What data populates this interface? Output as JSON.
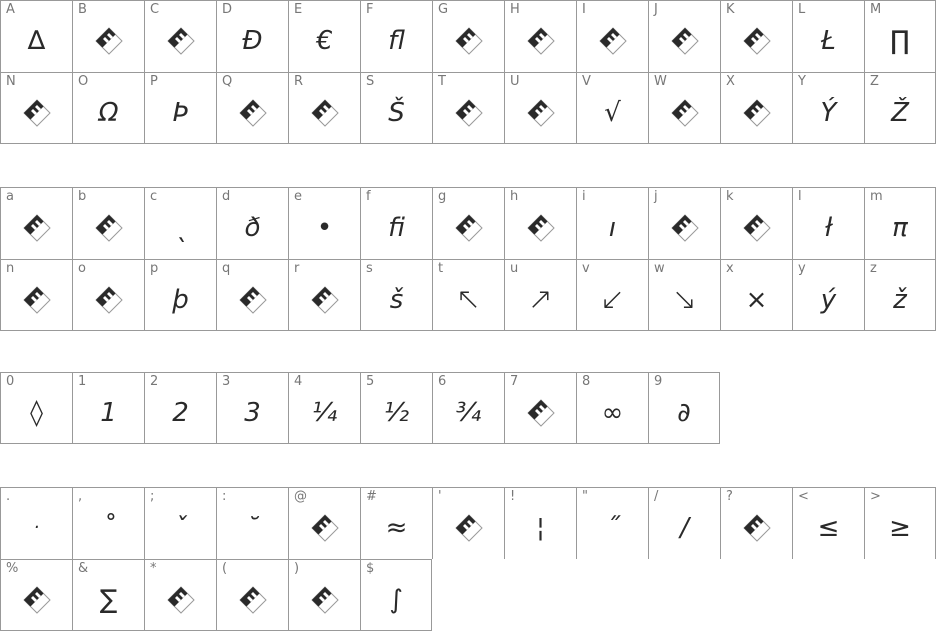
{
  "colors": {
    "border": "#999999",
    "label": "#777777",
    "glyph": "#2a2a2a",
    "placeholder_dark": "#2a2a2a",
    "placeholder_light": "#ffffff"
  },
  "placeholder_icon": "missing-glyph-icon",
  "sections": [
    {
      "name": "uppercase",
      "rows": [
        [
          {
            "label": "A",
            "glyph": "∆"
          },
          {
            "label": "B",
            "glyph": null
          },
          {
            "label": "C",
            "glyph": null
          },
          {
            "label": "D",
            "glyph": "Đ"
          },
          {
            "label": "E",
            "glyph": "€"
          },
          {
            "label": "F",
            "glyph": "fl"
          },
          {
            "label": "G",
            "glyph": null
          },
          {
            "label": "H",
            "glyph": null
          },
          {
            "label": "I",
            "glyph": null
          },
          {
            "label": "J",
            "glyph": null
          },
          {
            "label": "K",
            "glyph": null
          },
          {
            "label": "L",
            "glyph": "Ł"
          },
          {
            "label": "M",
            "glyph": "∏"
          }
        ],
        [
          {
            "label": "N",
            "glyph": null
          },
          {
            "label": "O",
            "glyph": "Ω"
          },
          {
            "label": "P",
            "glyph": "Þ"
          },
          {
            "label": "Q",
            "glyph": null
          },
          {
            "label": "R",
            "glyph": null
          },
          {
            "label": "S",
            "glyph": "Š"
          },
          {
            "label": "T",
            "glyph": null
          },
          {
            "label": "U",
            "glyph": null
          },
          {
            "label": "V",
            "glyph": "√"
          },
          {
            "label": "W",
            "glyph": null
          },
          {
            "label": "X",
            "glyph": null
          },
          {
            "label": "Y",
            "glyph": "Ý"
          },
          {
            "label": "Z",
            "glyph": "Ž"
          }
        ]
      ]
    },
    {
      "name": "lowercase",
      "rows": [
        [
          {
            "label": "a",
            "glyph": null
          },
          {
            "label": "b",
            "glyph": null
          },
          {
            "label": "c",
            "glyph": "ˎ"
          },
          {
            "label": "d",
            "glyph": "ð"
          },
          {
            "label": "e",
            "glyph": "•"
          },
          {
            "label": "f",
            "glyph": "fi"
          },
          {
            "label": "g",
            "glyph": null
          },
          {
            "label": "h",
            "glyph": null
          },
          {
            "label": "i",
            "glyph": "ı"
          },
          {
            "label": "j",
            "glyph": null
          },
          {
            "label": "k",
            "glyph": null
          },
          {
            "label": "l",
            "glyph": "ł"
          },
          {
            "label": "m",
            "glyph": "π"
          }
        ],
        [
          {
            "label": "n",
            "glyph": null
          },
          {
            "label": "o",
            "glyph": null
          },
          {
            "label": "p",
            "glyph": "þ"
          },
          {
            "label": "q",
            "glyph": null
          },
          {
            "label": "r",
            "glyph": null
          },
          {
            "label": "s",
            "glyph": "š"
          },
          {
            "label": "t",
            "glyph": "↖",
            "kind": "arrow"
          },
          {
            "label": "u",
            "glyph": "↗",
            "kind": "arrow"
          },
          {
            "label": "v",
            "glyph": "↙",
            "kind": "arrow"
          },
          {
            "label": "w",
            "glyph": "↘",
            "kind": "arrow"
          },
          {
            "label": "x",
            "glyph": "×"
          },
          {
            "label": "y",
            "glyph": "ý"
          },
          {
            "label": "z",
            "glyph": "ž"
          }
        ]
      ]
    },
    {
      "name": "digits",
      "rows": [
        [
          {
            "label": "0",
            "glyph": "◊"
          },
          {
            "label": "1",
            "glyph": "1"
          },
          {
            "label": "2",
            "glyph": "2"
          },
          {
            "label": "3",
            "glyph": "3"
          },
          {
            "label": "4",
            "glyph": "¼"
          },
          {
            "label": "5",
            "glyph": "½"
          },
          {
            "label": "6",
            "glyph": "¾"
          },
          {
            "label": "7",
            "glyph": null
          },
          {
            "label": "8",
            "glyph": "∞"
          },
          {
            "label": "9",
            "glyph": "∂"
          }
        ]
      ]
    },
    {
      "name": "punctuation",
      "rows": [
        [
          {
            "label": ".",
            "glyph": "·",
            "kind": "small"
          },
          {
            "label": ",",
            "glyph": "˚"
          },
          {
            "label": ";",
            "glyph": "ˇ"
          },
          {
            "label": ":",
            "glyph": "˘"
          },
          {
            "label": "@",
            "glyph": null
          },
          {
            "label": "#",
            "glyph": "≈"
          },
          {
            "label": "'",
            "glyph": null
          },
          {
            "label": "!",
            "glyph": "¦"
          },
          {
            "label": "\"",
            "glyph": "˝"
          },
          {
            "label": "/",
            "glyph": "/"
          },
          {
            "label": "?",
            "glyph": null
          },
          {
            "label": "<",
            "glyph": "≤"
          },
          {
            "label": ">",
            "glyph": "≥"
          }
        ],
        [
          {
            "label": "%",
            "glyph": null
          },
          {
            "label": "&",
            "glyph": "∑"
          },
          {
            "label": "*",
            "glyph": null
          },
          {
            "label": "(",
            "glyph": null
          },
          {
            "label": ")",
            "glyph": null
          },
          {
            "label": "$",
            "glyph": "∫"
          }
        ]
      ]
    }
  ]
}
